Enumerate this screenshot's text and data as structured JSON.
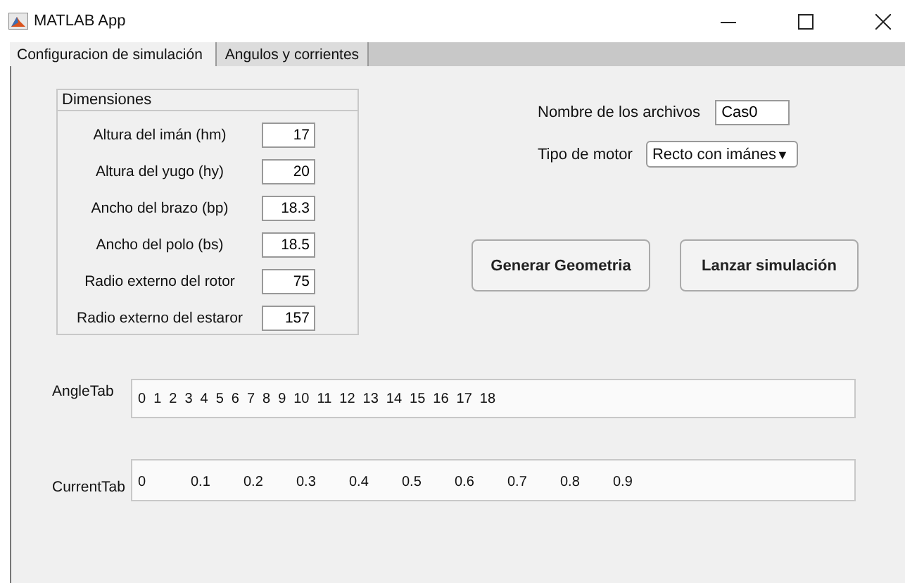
{
  "window": {
    "title": "MATLAB App"
  },
  "tabs": [
    {
      "label": "Configuracion de simulación",
      "selected": true
    },
    {
      "label": "Angulos y corrientes",
      "selected": false
    }
  ],
  "dimensions": {
    "title": "Dimensiones",
    "fields": [
      {
        "label": "Altura del imán (hm)",
        "value": "17"
      },
      {
        "label": "Altura del yugo (hy)",
        "value": "20"
      },
      {
        "label": "Ancho del brazo (bp)",
        "value": "18.3"
      },
      {
        "label": "Ancho del polo (bs)",
        "value": "18.5"
      },
      {
        "label": "Radio externo del rotor",
        "value": "75"
      },
      {
        "label": "Radio externo del estaror",
        "value": "157"
      }
    ]
  },
  "file_name": {
    "label": "Nombre de los archivos",
    "value": "Cas0"
  },
  "motor_type": {
    "label": "Tipo de motor",
    "value": "Recto con imánes",
    "arrow": "▼"
  },
  "buttons": [
    "Generar Geometria",
    "Lanzar simulación"
  ],
  "angle_tab": {
    "label": "AngleTab",
    "values": [
      "0",
      "1",
      "2",
      "3",
      "4",
      "5",
      "6",
      "7",
      "8",
      "9",
      "10",
      "11",
      "12",
      "13",
      "14",
      "15",
      "16",
      "17",
      "18"
    ]
  },
  "current_tab": {
    "label": "CurrentTab",
    "values": [
      "0",
      "0.1",
      "0.2",
      "0.3",
      "0.4",
      "0.5",
      "0.6",
      "0.7",
      "0.8",
      "0.9"
    ]
  }
}
